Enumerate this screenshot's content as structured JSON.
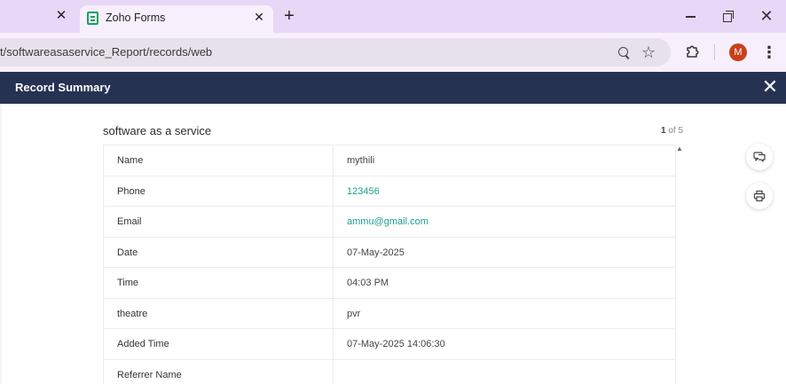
{
  "browser": {
    "tab_title": "Zoho Forms",
    "tab_close_glyph": "✕",
    "prev_tab_close_glyph": "✕",
    "new_tab_glyph": "+",
    "url": "t/softwareasaservice_Report/records/web",
    "avatar_letter": "M",
    "avatar_color": "#c8401c",
    "window_close_glyph": "✕"
  },
  "modal": {
    "title": "Record Summary",
    "close_glyph": "✕",
    "header_color": "#263252"
  },
  "record": {
    "form_title": "software as a service",
    "pager_current": "1",
    "pager_rest": " of 5",
    "fields": [
      {
        "label": "Name",
        "value": "mythili",
        "link": false
      },
      {
        "label": "Phone",
        "value": "123456",
        "link": true
      },
      {
        "label": "Email",
        "value": "ammu@gmail.com",
        "link": true
      },
      {
        "label": "Date",
        "value": "07-May-2025",
        "link": false
      },
      {
        "label": "Time",
        "value": "04:03 PM",
        "link": false
      },
      {
        "label": "theatre",
        "value": "pvr",
        "link": false
      },
      {
        "label": "Added Time",
        "value": "07-May-2025 14:06:30",
        "link": false
      },
      {
        "label": "Referrer Name",
        "value": "",
        "link": false
      }
    ],
    "link_color": "#1aa08f"
  },
  "icons": {
    "comment": "comment-icon",
    "print": "print-icon",
    "extensions": "puzzle-icon",
    "zoom": "zoom-icon",
    "bookmark": "star-icon"
  }
}
